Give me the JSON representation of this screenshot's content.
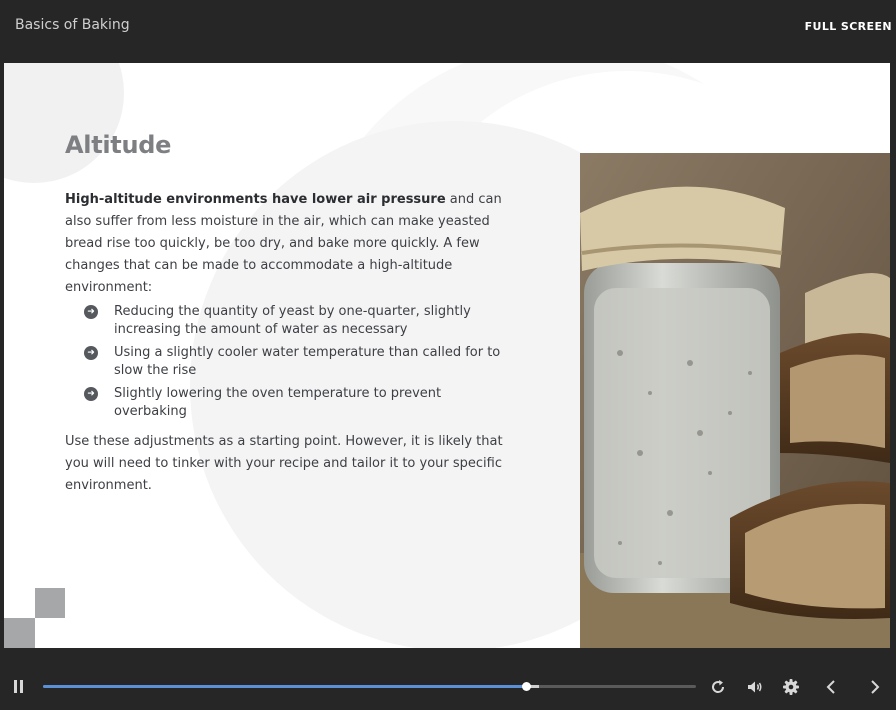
{
  "header": {
    "course_title": "Basics of Baking",
    "fullscreen_label": "FULL SCREEN"
  },
  "slide": {
    "heading": "Altitude",
    "intro_bold": "High-altitude environments have lower air pressure",
    "intro_rest": " and can also suffer from less moisture in the air, which can make yeasted bread rise too quickly, be too dry, and bake more quickly. A few changes that can be made to accommodate a high-altitude environment:",
    "bullets": [
      "Reducing the quantity of yeast by one-quarter, slightly increasing the amount of water as necessary",
      "Using a slightly cooler water temperature than called for to slow the rise",
      "Slightly lowering the oven temperature to prevent overbaking"
    ],
    "closing": "Use these adjustments as a starting point. However, it is likely that you will need to tinker with your recipe and tailor it to your specific environment."
  },
  "playback": {
    "progress": 0.74,
    "buffered": 0.76
  },
  "icons": {
    "pause": "pause-icon",
    "replay": "replay-icon",
    "volume": "volume-icon",
    "settings": "gear-icon",
    "previous": "chevron-left-icon",
    "next": "chevron-right-icon",
    "bullet": "arrow-circle-right-icon"
  },
  "colors": {
    "accent": "#5b8fd6",
    "chrome": "#262626",
    "heading": "#7d7f82"
  }
}
